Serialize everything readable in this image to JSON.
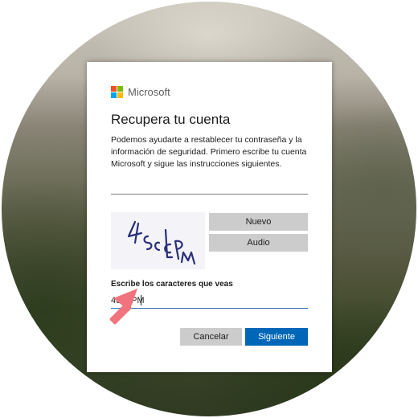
{
  "colors": {
    "ms_red": "#f25022",
    "ms_green": "#7fba00",
    "ms_blue": "#00a4ef",
    "ms_yellow": "#ffb900",
    "primary_button": "#0067b8",
    "secondary_button": "#cccccc",
    "arrow": "#f0737d",
    "captcha_text": "#2a2f7a"
  },
  "header": {
    "brand": "Microsoft",
    "brand_icon": "microsoft-logo-icon"
  },
  "dialog": {
    "title": "Recupera tu cuenta",
    "description": "Podemos ayudarte a restablecer tu contraseña y la información de seguridad. Primero escribe tu cuenta Microsoft y sigue las instrucciones siguientes."
  },
  "account_input": {
    "value": "",
    "placeholder": ""
  },
  "captcha": {
    "image_text": "4ScLPM",
    "new_label": "Nuevo",
    "audio_label": "Audio"
  },
  "captcha_input": {
    "label": "Escribe los caracteres que veas",
    "value": "4ScLPM"
  },
  "actions": {
    "cancel_label": "Cancelar",
    "next_label": "Siguiente"
  },
  "annotation": {
    "icon": "arrow-pointer-icon"
  }
}
